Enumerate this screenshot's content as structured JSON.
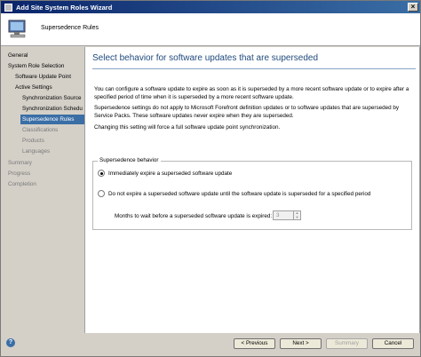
{
  "window": {
    "title": "Add Site System Roles Wizard",
    "close_glyph": "×"
  },
  "header": {
    "title": "Supersedence Rules"
  },
  "sidebar": {
    "items": [
      {
        "label": "General"
      },
      {
        "label": "System Role Selection"
      },
      {
        "label": "Software Update Point"
      },
      {
        "label": "Active Settings"
      },
      {
        "label": "Synchronization Source"
      },
      {
        "label": "Synchronization Schedule"
      },
      {
        "label": "Supersedence Rules"
      },
      {
        "label": "Classifications"
      },
      {
        "label": "Products"
      },
      {
        "label": "Languages"
      },
      {
        "label": "Summary"
      },
      {
        "label": "Progress"
      },
      {
        "label": "Completion"
      }
    ]
  },
  "main": {
    "title": "Select behavior for software updates that are superseded",
    "para1": "You can configure a software update to expire as soon as it is superseded by a more recent software update or to expire after a specified period of time when it is superseded by a more recent software update.",
    "para2": "Supersedence settings do not apply to Microsoft Forefront definition updates or to software updates that are superseded by Service Packs. These software updates never expire when they are superseded.",
    "para3": "Changing this setting will force a full software update point synchronization.",
    "group": {
      "legend": "Supersedence behavior",
      "option1": "Immediately expire a superseded software update",
      "option2": "Do not expire a superseded software update until the software update is superseded for a specified period",
      "months_label": "Months to wait before a superseded software update is expired:",
      "months_value": "3"
    }
  },
  "footer": {
    "help_glyph": "?",
    "previous": "< Previous",
    "next": "Next >",
    "summary": "Summary",
    "cancel": "Cancel"
  },
  "colors": {
    "accent": "#3a6ea5",
    "title_text": "#1f497d"
  }
}
